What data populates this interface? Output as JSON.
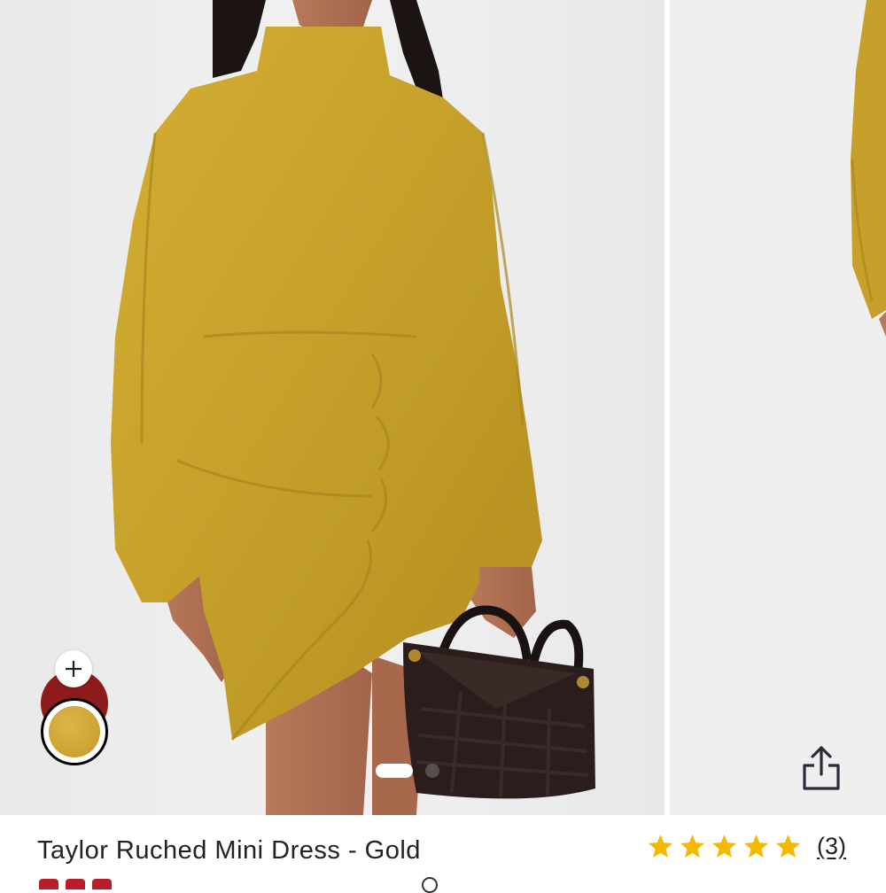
{
  "product": {
    "title": "Taylor Ruched Mini Dress - Gold",
    "rating": 5,
    "review_count_label": "(3)"
  },
  "gallery": {
    "slides_total": 3,
    "active_index": 0,
    "image_main": "model-in-gold-ruched-mini-dress-holding-black-woven-bag",
    "image_next": "model-in-gold-dress-partial-view"
  },
  "swatches": [
    {
      "name": "red",
      "color": "#8e1b1b",
      "selected": false
    },
    {
      "name": "gold",
      "color": "#c9a02f",
      "selected": true
    }
  ],
  "icons": {
    "add": "plus-icon",
    "share": "share-icon",
    "star": "star-icon"
  },
  "colors": {
    "star": "#f5b800",
    "price": "#b81d2a",
    "dress": "#c6a02a"
  }
}
